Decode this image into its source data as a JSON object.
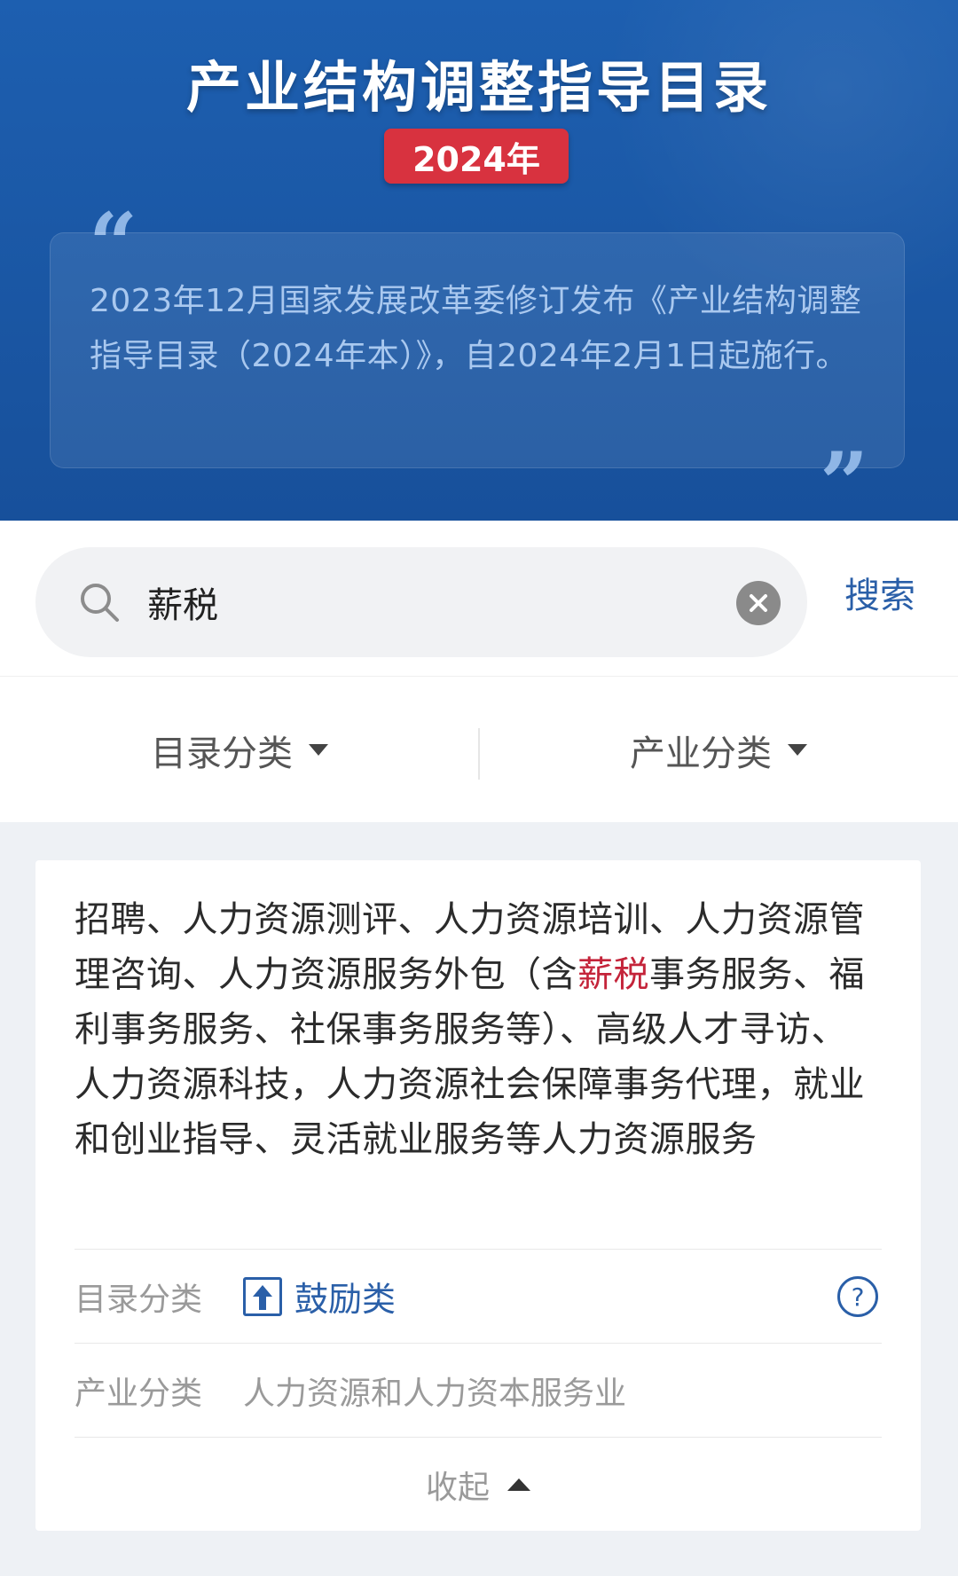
{
  "header": {
    "title": "产业结构调整指导目录",
    "year_badge": "2024年",
    "quote_open": "“",
    "quote_close": "”",
    "intro": "2023年12月国家发展改革委修订发布《产业结构调整指导目录（2024年本）》，自2024年2月1日起施行。"
  },
  "search": {
    "value": "薪税",
    "button_label": "搜索",
    "search_icon": "search-icon",
    "clear_icon": "clear-icon"
  },
  "filters": {
    "catalog_label": "目录分类",
    "industry_label": "产业分类"
  },
  "result": {
    "text_before": "招聘、人力资源测评、人力资源培训、人力资源管理咨询、人力资源服务外包（含",
    "text_highlight": "薪税",
    "text_after": "事务服务、福利事务服务、社保事务服务等）、高级人才寻访、人力资源科技，人力资源社会保障事务代理，就业和创业指导、灵活就业服务等人力资源服务",
    "catalog_label": "目录分类",
    "catalog_value": "鼓励类",
    "help_icon_text": "?",
    "industry_label": "产业分类",
    "industry_value": "人力资源和人力资本服务业",
    "collapse_label": "收起"
  },
  "colors": {
    "header_blue": "#1a56a3",
    "badge_red": "#d8323f",
    "link_blue": "#2a5fa8",
    "highlight_red": "#c4243a"
  }
}
